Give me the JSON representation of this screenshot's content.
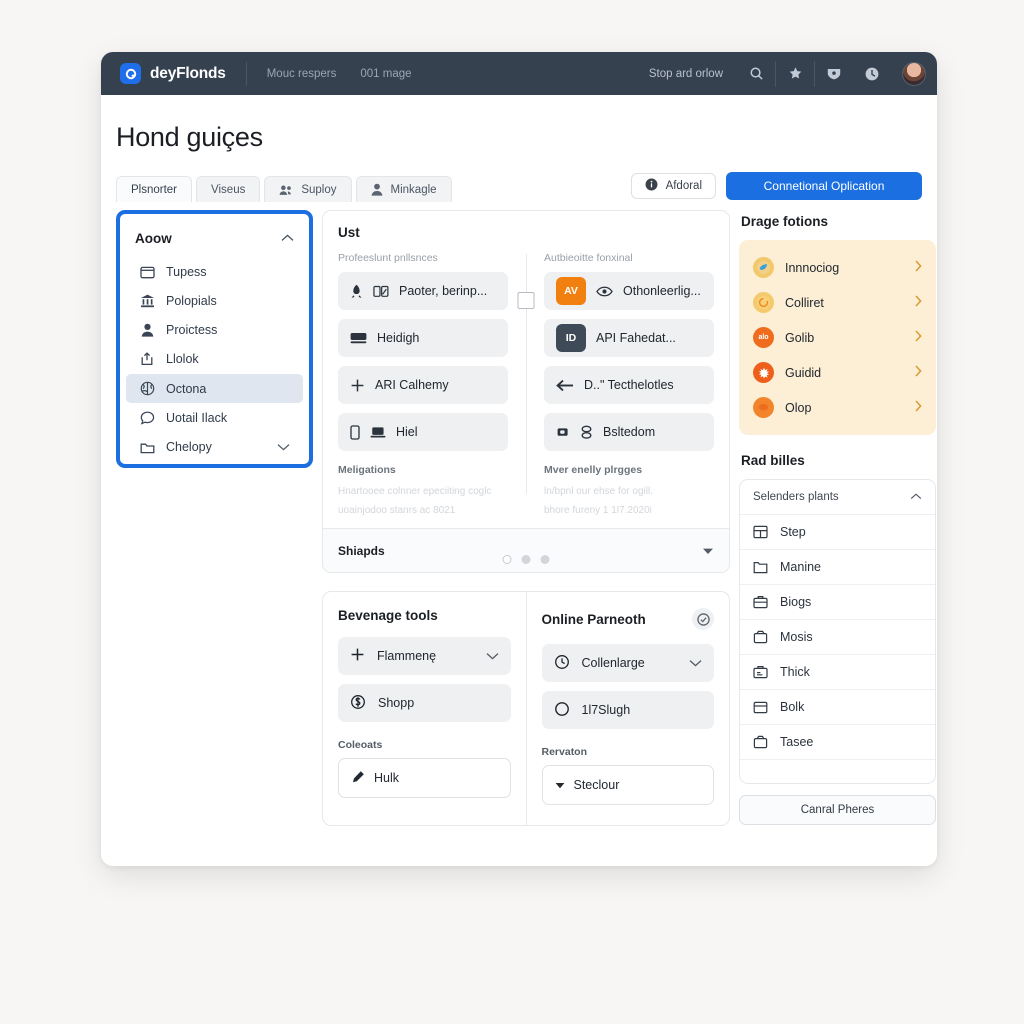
{
  "topbar": {
    "brand": "deyFlonds",
    "logo_icon": "app-logo-icon",
    "nav": [
      "Mouc respers",
      "001 mage"
    ],
    "right_label": "Stop ard orlow",
    "icons": [
      "search-icon",
      "star-icon",
      "shield-icon",
      "clock-icon",
      "avatar"
    ]
  },
  "page": {
    "title": "Hond guiçes",
    "tabs": [
      {
        "label": "Plsnorter",
        "icon": "",
        "active": true
      },
      {
        "label": "Viseus",
        "icon": "",
        "active": false
      },
      {
        "label": "Suploy",
        "icon": "people-icon",
        "active": false
      },
      {
        "label": "Minkagle",
        "icon": "person-icon",
        "active": false
      }
    ],
    "secondary_button": "Afdoral",
    "secondary_button_icon": "info-icon",
    "primary_button": "Connetional Oplication"
  },
  "sidebar": {
    "title": "Aoow",
    "collapse_icon": "chevron-up-icon",
    "items": [
      {
        "label": "Tupess",
        "icon": "window-icon",
        "selected": false,
        "chevron": false
      },
      {
        "label": "Polopials",
        "icon": "bank-icon",
        "selected": false,
        "chevron": false
      },
      {
        "label": "Proictess",
        "icon": "person-icon",
        "selected": false,
        "chevron": false
      },
      {
        "label": "Llolok",
        "icon": "upload-icon",
        "selected": false,
        "chevron": false
      },
      {
        "label": "Octona",
        "icon": "brain-icon",
        "selected": true,
        "chevron": false
      },
      {
        "label": "Uotail Ilack",
        "icon": "comment-icon",
        "selected": false,
        "chevron": false
      },
      {
        "label": "Chelopy",
        "icon": "folder-icon",
        "selected": false,
        "chevron": true
      }
    ]
  },
  "main_card": {
    "title": "Ust",
    "left": {
      "sub_label": "Profeeslunt pnllsnces",
      "rows": [
        {
          "label": "Paoter, berinp...",
          "icon": "rocket-icon",
          "icon2": "image-icon"
        },
        {
          "label": "Heidigh",
          "icon": "card-icon",
          "icon2": ""
        },
        {
          "label": "ARI  Calhemy",
          "icon": "plus-icon",
          "icon2": ""
        },
        {
          "label": "Hiel",
          "icon": "phone-icon",
          "icon2": "laptop-icon"
        }
      ],
      "note_title": "Meligations",
      "note_lines": [
        "Hnartooee colnner epeciiting coglc",
        "uoainjodoo stanrs ac 8021"
      ]
    },
    "right": {
      "sub_label": "Autbieoitte fonxinal",
      "rows": [
        {
          "label": "Othonleerlig...",
          "badge": "AV",
          "badge_color": "#f28010",
          "icon": "eye-icon"
        },
        {
          "label": "API  Fahedat...",
          "badge": "ID",
          "badge_color": "#3f4a58",
          "icon": ""
        },
        {
          "label": "D..\"  Tecthelotles",
          "badge": "",
          "badge_color": "",
          "icon": "arrow-left-icon"
        },
        {
          "label": "Bsltedom",
          "badge": "",
          "badge_color": "",
          "icon": "stack-icon"
        }
      ],
      "note_title": "Mver enelly plrgges",
      "note_lines": [
        "ln/bpnl our ehse for ogill.",
        "bhore fureny 1 1l7.2020i"
      ]
    },
    "bottom_label": "Shiapds",
    "bottom_caret": "caret-down-icon"
  },
  "tools_card": {
    "title": "Bevenage tools",
    "rows": [
      {
        "label": "Flammenę",
        "icon": "plus-icon",
        "chevron": true
      },
      {
        "label": "Shopp",
        "icon": "coin-icon",
        "chevron": false
      }
    ],
    "mini_label": "Coleoats",
    "field_value": "Hulk",
    "field_icon": "pencil-icon"
  },
  "payment_card": {
    "title": "Online Parneoth",
    "head_icon": "check-circle-icon",
    "rows": [
      {
        "label": "Collenlarge",
        "icon": "clock-arrow-icon",
        "chevron": true
      },
      {
        "label": "1l7Slugh",
        "icon": "radio-icon",
        "chevron": false
      }
    ],
    "mini_label": "Rervaton",
    "field_value": "Steclour",
    "field_icon": "caret-down-icon"
  },
  "right_panel": {
    "promo_title": "Drage fotions",
    "promo_items": [
      {
        "label": "Innnociog",
        "color": "#f2c86a",
        "mono": ""
      },
      {
        "label": "Colliret",
        "color": "#f5b544",
        "mono": ""
      },
      {
        "label": "Golib",
        "color": "#ef6c1f",
        "mono": "alo"
      },
      {
        "label": "Guidid",
        "color": "#ef5f1c",
        "mono": ""
      },
      {
        "label": "Olop",
        "color": "#f07021",
        "mono": ""
      }
    ],
    "list_title": "Rad billes",
    "list_head": "Selenders plants",
    "list_head_icon": "chevron-up-icon",
    "list_items": [
      {
        "label": "Step",
        "icon": "grid-icon"
      },
      {
        "label": "Manine",
        "icon": "folder-icon"
      },
      {
        "label": "Biogs",
        "icon": "briefcase-icon"
      },
      {
        "label": "Mosis",
        "icon": "archive-icon"
      },
      {
        "label": "Thick",
        "icon": "toolbox-icon"
      },
      {
        "label": "Bolk",
        "icon": "calendar-icon"
      },
      {
        "label": "Tasee",
        "icon": "box-icon"
      }
    ],
    "footer_button": "Canral Pheres"
  },
  "colors": {
    "accent": "#1c6fe0",
    "topbar": "#36414f",
    "cream": "#fcefd6",
    "orange": "#f28010",
    "slate": "#3f4a58",
    "page_bg": "#f7f6f4"
  }
}
